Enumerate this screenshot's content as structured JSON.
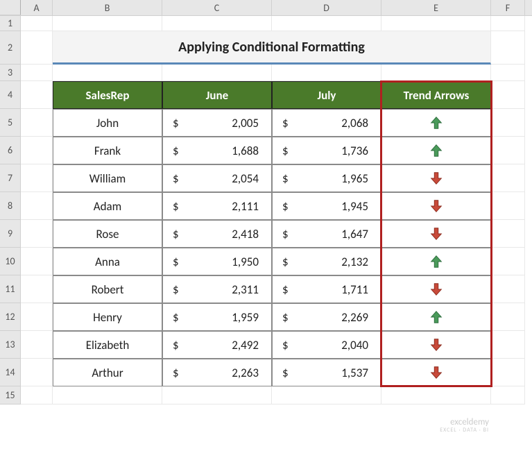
{
  "columns": [
    "A",
    "B",
    "C",
    "D",
    "E",
    "F"
  ],
  "row_numbers": [
    1,
    2,
    3,
    4,
    5,
    6,
    7,
    8,
    9,
    10,
    11,
    12,
    13,
    14,
    15
  ],
  "title": "Applying Conditional Formatting",
  "headers": {
    "salesrep": "SalesRep",
    "june": "June",
    "july": "July",
    "trend": "Trend Arrows"
  },
  "rows": [
    {
      "name": "John",
      "june": "2,005",
      "july": "2,068",
      "trend": "up"
    },
    {
      "name": "Frank",
      "june": "1,688",
      "july": "1,736",
      "trend": "up"
    },
    {
      "name": "William",
      "june": "2,054",
      "july": "1,965",
      "trend": "down"
    },
    {
      "name": "Adam",
      "june": "2,111",
      "july": "1,945",
      "trend": "down"
    },
    {
      "name": "Rose",
      "june": "2,418",
      "july": "1,647",
      "trend": "down"
    },
    {
      "name": "Anna",
      "june": "1,950",
      "july": "2,132",
      "trend": "up"
    },
    {
      "name": "Robert",
      "june": "2,311",
      "july": "1,711",
      "trend": "down"
    },
    {
      "name": "Henry",
      "june": "1,959",
      "july": "2,269",
      "trend": "up"
    },
    {
      "name": "Elizabeth",
      "june": "2,492",
      "july": "2,040",
      "trend": "down"
    },
    {
      "name": "Arthur",
      "june": "2,263",
      "july": "1,537",
      "trend": "down"
    }
  ],
  "currency_symbol": "$",
  "watermark": {
    "main": "exceldemy",
    "sub": "EXCEL · DATA · BI"
  },
  "chart_data": {
    "type": "table",
    "title": "Applying Conditional Formatting",
    "columns": [
      "SalesRep",
      "June",
      "July",
      "Trend Arrows"
    ],
    "series": [
      {
        "name": "June",
        "values": [
          2005,
          1688,
          2054,
          2111,
          2418,
          1950,
          2311,
          1959,
          2492,
          2263
        ]
      },
      {
        "name": "July",
        "values": [
          2068,
          1736,
          1965,
          1945,
          1647,
          2132,
          1711,
          2269,
          2040,
          1537
        ]
      }
    ],
    "categories": [
      "John",
      "Frank",
      "William",
      "Adam",
      "Rose",
      "Anna",
      "Robert",
      "Henry",
      "Elizabeth",
      "Arthur"
    ]
  }
}
